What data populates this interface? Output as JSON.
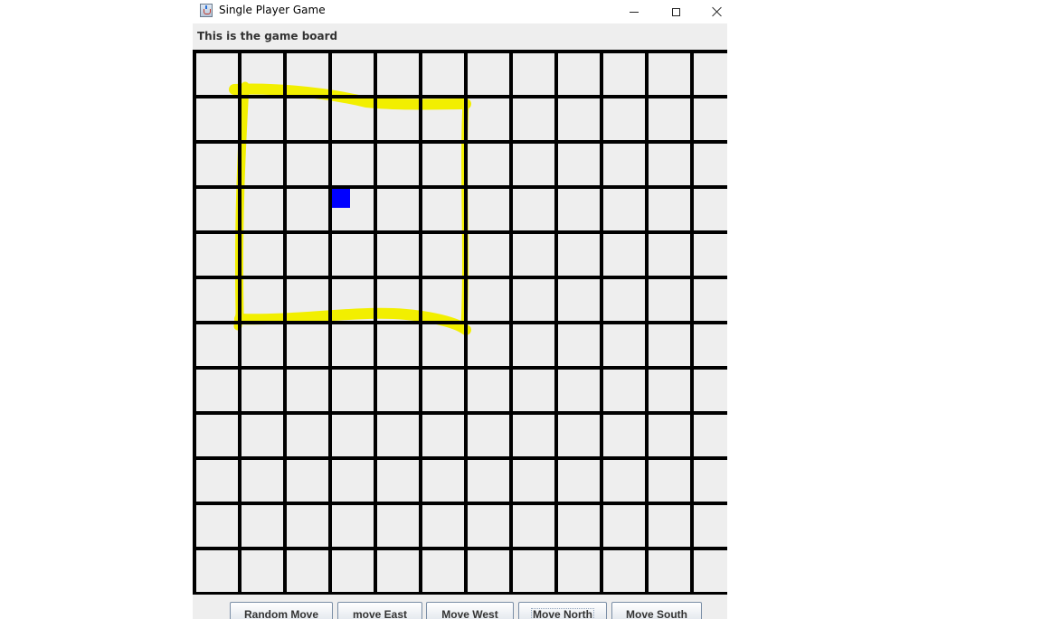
{
  "window": {
    "title": "Single Player Game",
    "controls": [
      "minimize",
      "maximize",
      "close"
    ]
  },
  "board": {
    "label": "This is the game board",
    "columns": 12,
    "rows": 12,
    "background_color": "#eeeeee",
    "grid_color": "#000000",
    "player": {
      "column": 3,
      "row": 3,
      "color": "#0000ff"
    },
    "highlight": {
      "color": "#f2ef00",
      "from_column": 1,
      "to_column": 6,
      "from_row": 1,
      "to_row": 6
    }
  },
  "buttons": {
    "random": "Random Move",
    "east": "move East",
    "west": "Move West",
    "north": "Move North",
    "south": "Move South"
  }
}
